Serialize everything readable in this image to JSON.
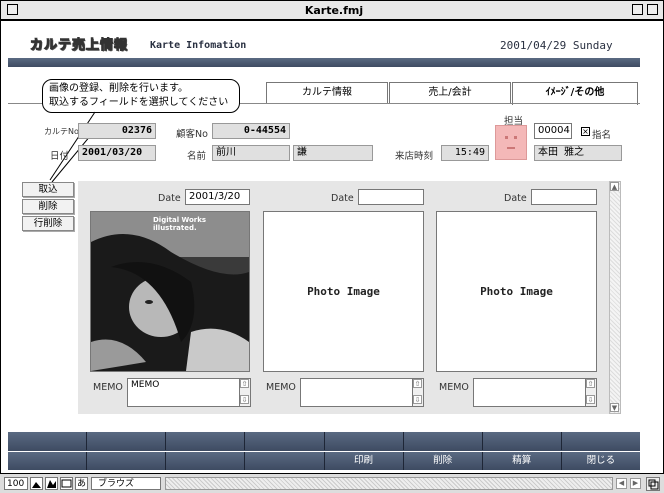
{
  "window": {
    "title": "Karte.fmj"
  },
  "header": {
    "logo": "カルテ売上情報",
    "app_title": "Karte Infomation",
    "date": "2001/04/29 Sunday"
  },
  "callout": {
    "line1": "画像の登録、削除を行います。",
    "line2": "取込するフィールドを選択してください"
  },
  "tabs": [
    {
      "label": "カルテ情報"
    },
    {
      "label": "売上/会計"
    },
    {
      "label": "ｲﾒｰｼﾞ/その他"
    }
  ],
  "record": {
    "karte_no_label": "カルテNo",
    "karte_no": "02376",
    "customer_no_label": "顧客No",
    "customer_no": "0-44554",
    "date_label": "日付",
    "date": "2001/03/20",
    "name_label": "名前",
    "last_name": "前川",
    "first_name": "謙",
    "visit_label": "来店時刻",
    "visit_time": "15:49",
    "staff_label": "担当",
    "staff_code": "00004",
    "nominate_label": "指名",
    "staff_name": "本田 雅之"
  },
  "side_buttons": [
    {
      "label": "取込"
    },
    {
      "label": "削除"
    },
    {
      "label": "行削除"
    }
  ],
  "photos": [
    {
      "date_label": "Date",
      "date": "2001/3/20",
      "caption": "Digital Works illustrated.",
      "memo_label": "MEMO",
      "memo": "MEMO"
    },
    {
      "date_label": "Date",
      "date": "",
      "caption": "Photo Image",
      "memo_label": "MEMO",
      "memo": ""
    },
    {
      "date_label": "Date",
      "date": "",
      "caption": "Photo Image",
      "memo_label": "MEMO",
      "memo": ""
    }
  ],
  "bottom_buttons": [
    {
      "label": ""
    },
    {
      "label": ""
    },
    {
      "label": ""
    },
    {
      "label": ""
    },
    {
      "label": "印刷"
    },
    {
      "label": "削除"
    },
    {
      "label": "精算"
    },
    {
      "label": "閉じる"
    }
  ],
  "status": {
    "zoom": "100",
    "mode": "ブラウズ"
  },
  "colors": {
    "bar_dark": "#4a576e",
    "panel_gray": "#e6e6e6",
    "staff_pink": "#f4b8b8"
  }
}
